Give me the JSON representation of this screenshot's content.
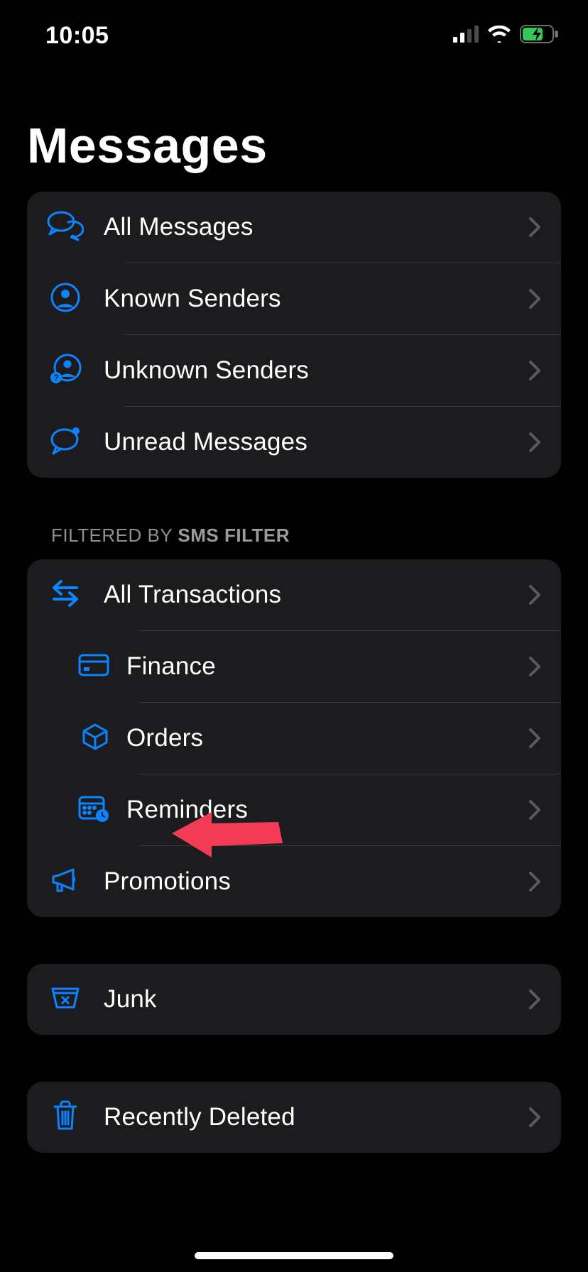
{
  "status": {
    "time": "10:05"
  },
  "title": "Messages",
  "sections": {
    "main": {
      "all_messages": "All Messages",
      "known_senders": "Known Senders",
      "unknown_senders": "Unknown Senders",
      "unread_messages": "Unread Messages"
    },
    "filter_header_prefix": "FILTERED BY ",
    "filter_header_bold": "SMS FILTER",
    "filtered": {
      "all_transactions": "All Transactions",
      "finance": "Finance",
      "orders": "Orders",
      "reminders": "Reminders",
      "promotions": "Promotions"
    },
    "junk": {
      "label": "Junk"
    },
    "deleted": {
      "label": "Recently Deleted"
    }
  },
  "colors": {
    "accent": "#0a84ff",
    "annotation": "#f43b56"
  }
}
